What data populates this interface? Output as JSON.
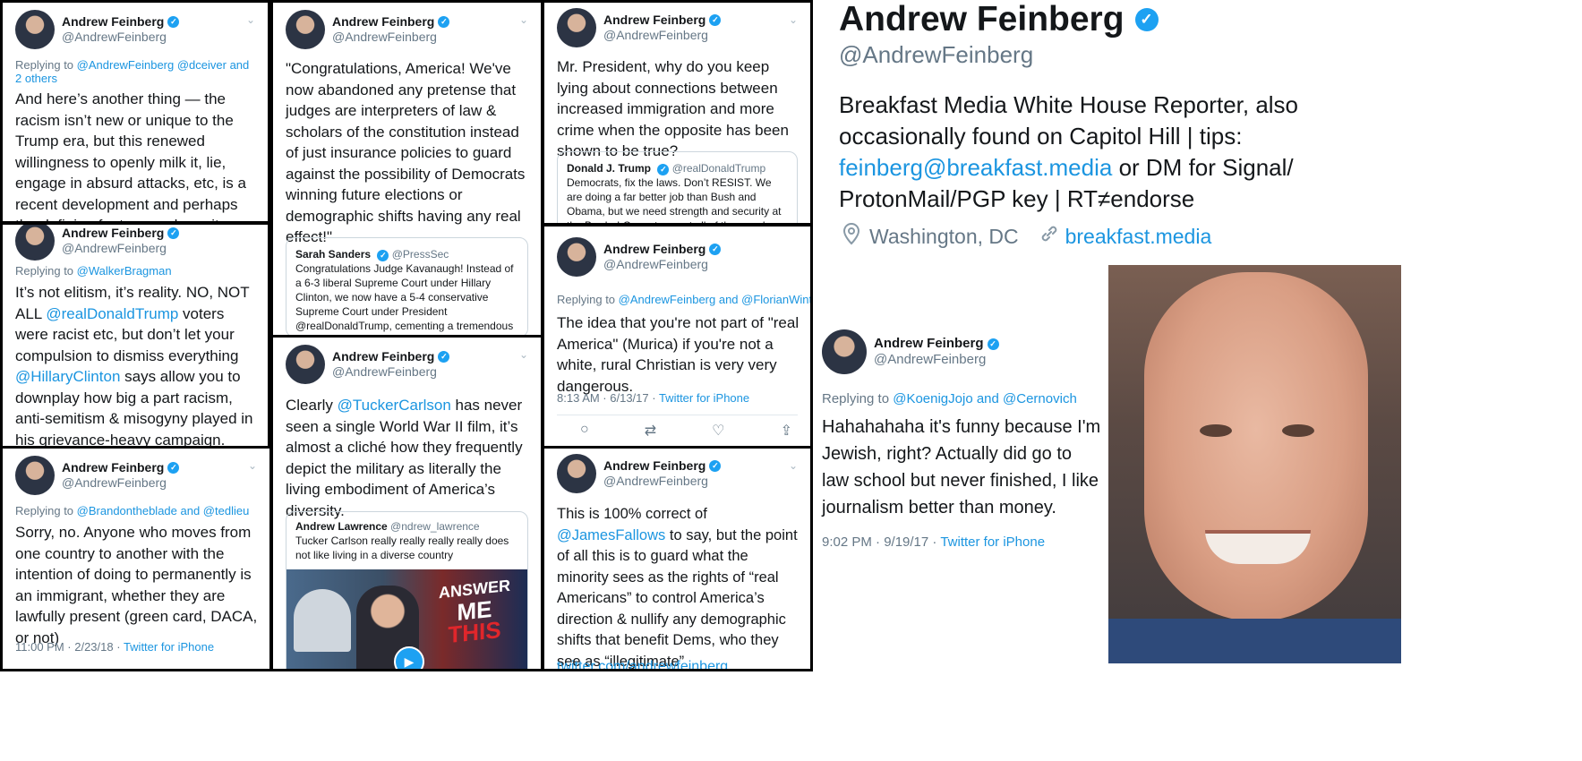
{
  "common": {
    "name": "Andrew Feinberg",
    "handle": "@AndrewFeinberg"
  },
  "t1": {
    "reply_prefix": "Replying to ",
    "reply_to": "@AndrewFeinberg @dceiver and 2 others",
    "text": "And here’s another thing — the racism isn’t new or unique to the Trump era, but this renewed willingness to openly milk it, lie, engage in absurd attacks, etc, is a recent development and perhaps the defining feature, as he writes here."
  },
  "t2": {
    "reply_prefix": "Replying to ",
    "reply_to": "@WalkerBragman",
    "p1": "It’s not elitism, it’s reality. NO, NOT ALL ",
    "m1": "@realDonaldTrump",
    "p2": " voters were racist etc, but don’t let your compulsion to dismiss everything ",
    "m2": "@HillaryClinton",
    "p3": " says allow you to downplay how big a part racism, anti-semitism & misogyny played in his grievance-heavy campaign."
  },
  "t3": {
    "reply_prefix": "Replying to ",
    "reply_to": "@Brandontheblade and @tedlieu",
    "text": "Sorry, no. Anyone who moves from one country to another with the intention of doing to permanently is an immigrant, whether they are lawfully present (green card, DACA, or not)",
    "time": "11:00 PM · 2/23/18 · ",
    "source": "Twitter for iPhone"
  },
  "t4": {
    "text": "\"Congratulations, America! We've now abandoned any pretense that judges are interpreters of law & scholars of the constitution instead of just insurance policies to guard against the possibility of Democrats winning future elections or demographic shifts having any real effect!\"",
    "quote_name": "Sarah Sanders",
    "quote_handle": "@PressSec",
    "quote_text": "Congratulations Judge Kavanaugh! Instead of a 6-3 liberal Supreme Court under Hillary Clinton, we now have a 5-4 conservative Supreme Court under President @realDonaldTrump, cementing a tremendous legacy for the Presi..."
  },
  "t5": {
    "p1": "Clearly ",
    "m1": "@TuckerCarlson",
    "p2": " has never seen a single World War II film, it’s almost a cliché how they frequently depict the military as literally the living embodiment of America’s diversity.",
    "quote_name": "Andrew Lawrence",
    "quote_handle": "@ndrew_lawrence",
    "quote_text": "Tucker Carlson really really really really does not like living in a diverse country",
    "banner_1": "ANSWER",
    "banner_2": "ME",
    "banner_3": "THIS"
  },
  "t6": {
    "text": "Mr. President, why do you keep lying about connections between increased immigration and more crime when the opposite has been shown to be true?",
    "quote_name": "Donald J. Trump",
    "quote_handle": "@realDonaldTrump",
    "quote_text": "Democrats, fix the laws. Don’t RESIST. We are doing a far better job than Bush and Obama, but we need strength and security at the Border! Cannot accept all of the people trying"
  },
  "t7": {
    "reply_prefix": "Replying to ",
    "reply_to": "@AndrewFeinberg and @FlorianWinter",
    "text": "The idea that you're not part of \"real America\" (Murica) if you're not a white, rural Christian is very very dangerous.",
    "time": "8:13 AM · 6/13/17 · ",
    "source": "Twitter for iPhone"
  },
  "t8": {
    "p1": "This is 100% correct of ",
    "m1": "@JamesFallows",
    "p2": " to say, but the point of all this is to guard what the minority sees as the rights of “real Americans” to control America’s direction & nullify any demographic shifts that benefit Dems, who they see as “illegitimate”",
    "link": "twitter.com/andrewfeinberg..."
  },
  "t9": {
    "reply_prefix": "Replying to ",
    "reply_to": "@KoenigJojo and @Cernovich",
    "text": "Hahahahaha it's funny because I'm Jewish, right? Actually did go to law school but never finished, I like journalism better than money.",
    "time": "9:02 PM · 9/19/17 · ",
    "source": "Twitter for iPhone"
  },
  "profile": {
    "name": "Andrew Feinberg",
    "handle": "@AndrewFeinberg",
    "bio_1": "Breakfast Media White House Reporter, also occasionally found on Capitol Hill | tips: ",
    "bio_email": "feinberg@breakfast.media",
    "bio_2": " or DM for Signal/ ProtonMail/PGP key | RT≠endorse",
    "location": "Washington, DC",
    "website": "breakfast.media"
  },
  "colors": {
    "link": "#1b95e0",
    "secondary": "#657786",
    "verified": "#1da1f2"
  },
  "icons": {
    "verified": "verified-badge-icon",
    "chevron": "chevron-down-icon",
    "location": "location-pin-icon",
    "link": "link-icon",
    "actions": [
      "reply-icon",
      "retweet-icon",
      "like-icon",
      "share-icon"
    ],
    "play": "play-icon"
  }
}
